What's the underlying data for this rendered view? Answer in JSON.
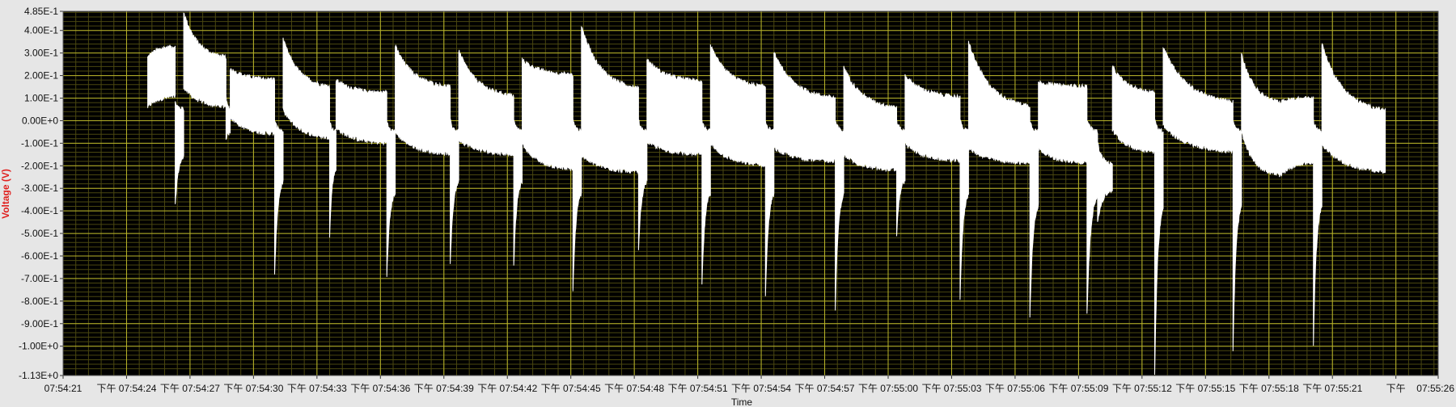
{
  "colors": {
    "plot_background": "#000000",
    "major_grid": "#b9b52a",
    "minor_grid": "#4a4710",
    "trace": "#ffffff",
    "ylabel": "#e0201e",
    "frame": "#e6e6e6"
  },
  "chart_data": {
    "type": "line",
    "title": "",
    "xlabel": "Time",
    "ylabel": "Voltage (V)",
    "ylim": [
      -1.13,
      0.485
    ],
    "xlim_seconds": [
      0,
      65
    ],
    "grid": true,
    "legend": "none",
    "y_ticks": [
      {
        "value": 0.485,
        "label": "4.85E-1"
      },
      {
        "value": 0.4,
        "label": "4.00E-1"
      },
      {
        "value": 0.3,
        "label": "3.00E-1"
      },
      {
        "value": 0.2,
        "label": "2.00E-1"
      },
      {
        "value": 0.1,
        "label": "1.00E-1"
      },
      {
        "value": 0.0,
        "label": "0.00E+0"
      },
      {
        "value": -0.1,
        "label": "-1.00E-1"
      },
      {
        "value": -0.2,
        "label": "-2.00E-1"
      },
      {
        "value": -0.3,
        "label": "-3.00E-1"
      },
      {
        "value": -0.4,
        "label": "-4.00E-1"
      },
      {
        "value": -0.5,
        "label": "-5.00E-1"
      },
      {
        "value": -0.6,
        "label": "-6.00E-1"
      },
      {
        "value": -0.7,
        "label": "-7.00E-1"
      },
      {
        "value": -0.8,
        "label": "-8.00E-1"
      },
      {
        "value": -0.9,
        "label": "-9.00E-1"
      },
      {
        "value": -1.0,
        "label": "-1.00E+0"
      },
      {
        "value": -1.13,
        "label": "-1.13E+0"
      }
    ],
    "x_ticks": [
      {
        "value": 0,
        "label": "07:54:21"
      },
      {
        "value": 3,
        "label": "下午 07:54:24"
      },
      {
        "value": 6,
        "label": "下午 07:54:27"
      },
      {
        "value": 9,
        "label": "下午 07:54:30"
      },
      {
        "value": 12,
        "label": "下午 07:54:33"
      },
      {
        "value": 15,
        "label": "下午 07:54:36"
      },
      {
        "value": 18,
        "label": "下午 07:54:39"
      },
      {
        "value": 21,
        "label": "下午 07:54:42"
      },
      {
        "value": 24,
        "label": "下午 07:54:45"
      },
      {
        "value": 27,
        "label": "下午 07:54:48"
      },
      {
        "value": 30,
        "label": "下午 07:54:51"
      },
      {
        "value": 33,
        "label": "下午 07:54:54"
      },
      {
        "value": 36,
        "label": "下午 07:54:57"
      },
      {
        "value": 39,
        "label": "下午 07:55:00"
      },
      {
        "value": 42,
        "label": "下午 07:55:03"
      },
      {
        "value": 45,
        "label": "下午 07:55:06"
      },
      {
        "value": 48,
        "label": "下午 07:55:09"
      },
      {
        "value": 51,
        "label": "下午 07:55:12"
      },
      {
        "value": 54,
        "label": "下午 07:55:15"
      },
      {
        "value": 57,
        "label": "下午 07:55:18"
      },
      {
        "value": 60,
        "label": "下午 07:55:21"
      },
      {
        "value": 63,
        "label": "下午"
      },
      {
        "value": 65,
        "label": "07:55:26"
      }
    ],
    "series": [
      {
        "segments": [
          {
            "x0": 4.0,
            "x1": 5.3,
            "hi_start": 0.28,
            "hi_end": 0.33,
            "lo_start": 0.06,
            "lo_end": 0.11
          },
          {
            "x0": 5.3,
            "x1": 5.7,
            "hi_start": 0.08,
            "hi_end": 0.05,
            "lo_start": -0.38,
            "lo_end": -0.15
          },
          {
            "x0": 5.7,
            "x1": 7.7,
            "hi_start": 0.48,
            "hi_end": 0.27,
            "lo_start": 0.15,
            "lo_end": 0.06
          },
          {
            "x0": 7.7,
            "x1": 7.9,
            "hi_start": 0.1,
            "hi_end": 0.05,
            "lo_start": -0.08,
            "lo_end": -0.05
          },
          {
            "x0": 7.9,
            "x1": 10.0,
            "hi_start": 0.23,
            "hi_end": 0.18,
            "lo_start": 0.02,
            "lo_end": -0.06
          },
          {
            "x0": 10.0,
            "x1": 10.4,
            "hi_start": 0.0,
            "hi_end": -0.05,
            "lo_start": -0.69,
            "lo_end": -0.25
          },
          {
            "x0": 10.4,
            "x1": 12.6,
            "hi_start": 0.36,
            "hi_end": 0.14,
            "lo_start": 0.05,
            "lo_end": -0.08
          },
          {
            "x0": 12.6,
            "x1": 12.9,
            "hi_start": 0.0,
            "hi_end": -0.05,
            "lo_start": -0.52,
            "lo_end": -0.2
          },
          {
            "x0": 12.9,
            "x1": 15.3,
            "hi_start": 0.18,
            "hi_end": 0.12,
            "lo_start": -0.03,
            "lo_end": -0.1
          },
          {
            "x0": 15.3,
            "x1": 15.7,
            "hi_start": 0.0,
            "hi_end": -0.05,
            "lo_start": -0.7,
            "lo_end": -0.3
          },
          {
            "x0": 15.7,
            "x1": 18.3,
            "hi_start": 0.33,
            "hi_end": 0.14,
            "lo_start": -0.05,
            "lo_end": -0.15
          },
          {
            "x0": 18.3,
            "x1": 18.7,
            "hi_start": 0.0,
            "hi_end": -0.05,
            "lo_start": -0.64,
            "lo_end": -0.25
          },
          {
            "x0": 18.7,
            "x1": 21.3,
            "hi_start": 0.31,
            "hi_end": 0.1,
            "lo_start": -0.08,
            "lo_end": -0.15
          },
          {
            "x0": 21.3,
            "x1": 21.7,
            "hi_start": 0.0,
            "hi_end": -0.05,
            "lo_start": -0.65,
            "lo_end": -0.25
          },
          {
            "x0": 21.7,
            "x1": 24.1,
            "hi_start": 0.27,
            "hi_end": 0.2,
            "lo_start": -0.1,
            "lo_end": -0.22
          },
          {
            "x0": 24.1,
            "x1": 24.5,
            "hi_start": 0.0,
            "hi_end": -0.05,
            "lo_start": -0.76,
            "lo_end": -0.3
          },
          {
            "x0": 24.5,
            "x1": 27.2,
            "hi_start": 0.42,
            "hi_end": 0.13,
            "lo_start": -0.15,
            "lo_end": -0.23
          },
          {
            "x0": 27.2,
            "x1": 27.6,
            "hi_start": 0.0,
            "hi_end": -0.05,
            "lo_start": -0.58,
            "lo_end": -0.25
          },
          {
            "x0": 27.6,
            "x1": 30.2,
            "hi_start": 0.27,
            "hi_end": 0.17,
            "lo_start": -0.09,
            "lo_end": -0.15
          },
          {
            "x0": 30.2,
            "x1": 30.6,
            "hi_start": 0.0,
            "hi_end": -0.05,
            "lo_start": -0.73,
            "lo_end": -0.3
          },
          {
            "x0": 30.6,
            "x1": 33.2,
            "hi_start": 0.33,
            "hi_end": 0.14,
            "lo_start": -0.1,
            "lo_end": -0.2
          },
          {
            "x0": 33.2,
            "x1": 33.6,
            "hi_start": 0.0,
            "hi_end": -0.05,
            "lo_start": -0.78,
            "lo_end": -0.3
          },
          {
            "x0": 33.6,
            "x1": 36.5,
            "hi_start": 0.3,
            "hi_end": 0.09,
            "lo_start": -0.12,
            "lo_end": -0.18
          },
          {
            "x0": 36.5,
            "x1": 36.9,
            "hi_start": 0.0,
            "hi_end": -0.05,
            "lo_start": -0.84,
            "lo_end": -0.3
          },
          {
            "x0": 36.9,
            "x1": 39.4,
            "hi_start": 0.24,
            "hi_end": 0.05,
            "lo_start": -0.15,
            "lo_end": -0.22
          },
          {
            "x0": 39.4,
            "x1": 39.8,
            "hi_start": 0.0,
            "hi_end": -0.05,
            "lo_start": -0.51,
            "lo_end": -0.25
          },
          {
            "x0": 39.8,
            "x1": 42.4,
            "hi_start": 0.2,
            "hi_end": 0.1,
            "lo_start": -0.1,
            "lo_end": -0.18
          },
          {
            "x0": 42.4,
            "x1": 42.8,
            "hi_start": 0.0,
            "hi_end": -0.05,
            "lo_start": -0.79,
            "lo_end": -0.3
          },
          {
            "x0": 42.8,
            "x1": 45.7,
            "hi_start": 0.35,
            "hi_end": 0.05,
            "lo_start": -0.12,
            "lo_end": -0.19
          },
          {
            "x0": 45.7,
            "x1": 46.1,
            "hi_start": 0.0,
            "hi_end": -0.05,
            "lo_start": -0.88,
            "lo_end": -0.35
          },
          {
            "x0": 46.1,
            "x1": 48.4,
            "hi_start": 0.17,
            "hi_end": 0.15,
            "lo_start": -0.12,
            "lo_end": -0.19
          },
          {
            "x0": 48.4,
            "x1": 48.9,
            "hi_start": 0.0,
            "hi_end": -0.05,
            "lo_start": -0.86,
            "lo_end": -0.3
          },
          {
            "x0": 48.9,
            "x1": 49.6,
            "hi_start": -0.1,
            "hi_end": -0.2,
            "lo_start": -0.45,
            "lo_end": -0.3
          },
          {
            "x0": 49.6,
            "x1": 51.6,
            "hi_start": 0.24,
            "hi_end": 0.12,
            "lo_start": -0.04,
            "lo_end": -0.14
          },
          {
            "x0": 51.6,
            "x1": 52.0,
            "hi_start": 0.0,
            "hi_end": -0.05,
            "lo_start": -1.12,
            "lo_end": -0.35
          },
          {
            "x0": 52.0,
            "x1": 55.3,
            "hi_start": 0.33,
            "hi_end": 0.07,
            "lo_start": -0.02,
            "lo_end": -0.14
          },
          {
            "x0": 55.3,
            "x1": 55.7,
            "hi_start": 0.0,
            "hi_end": -0.05,
            "lo_start": -1.02,
            "lo_end": -0.35
          },
          {
            "x0": 55.7,
            "x1": 57.5,
            "hi_start": 0.3,
            "hi_end": 0.07,
            "lo_start": -0.05,
            "lo_end": -0.25
          },
          {
            "x0": 57.5,
            "x1": 59.1,
            "hi_start": 0.08,
            "hi_end": 0.1,
            "lo_start": -0.25,
            "lo_end": -0.18
          },
          {
            "x0": 59.1,
            "x1": 59.5,
            "hi_start": 0.0,
            "hi_end": -0.05,
            "lo_start": -1.0,
            "lo_end": -0.35
          },
          {
            "x0": 59.5,
            "x1": 62.5,
            "hi_start": 0.34,
            "hi_end": 0.03,
            "lo_start": -0.1,
            "lo_end": -0.23
          }
        ]
      }
    ]
  }
}
